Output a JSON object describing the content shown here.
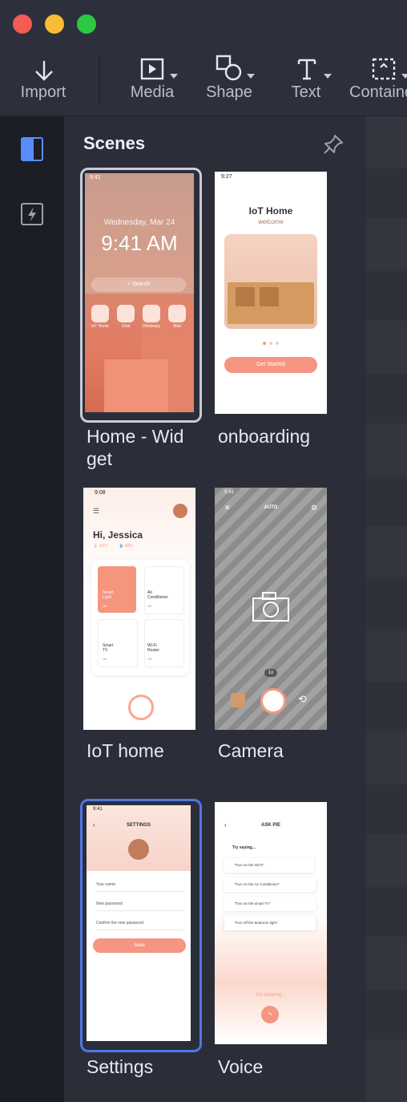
{
  "window": {
    "traffic_lights": [
      "#f35b53",
      "#f8bd34",
      "#2cc840"
    ]
  },
  "toolbar": {
    "import_label": "Import",
    "media_label": "Media",
    "shape_label": "Shape",
    "text_label": "Text",
    "container_label": "Containe"
  },
  "panel": {
    "title": "Scenes"
  },
  "scenes": [
    {
      "label": "Home - Wid\nget",
      "status_time": "9:41",
      "date": "Wednesday, Mar 24",
      "time": "9:41 AM",
      "search": "Search",
      "apps": [
        "IoT Home",
        "Chat",
        "Dictionary",
        "Mail"
      ]
    },
    {
      "label": "onboarding",
      "status_time": "9:27",
      "title": "IoT Home",
      "subtitle": "welcome",
      "cta": "Get Started"
    },
    {
      "label": "IoT home",
      "status_time": "9:08",
      "greeting": "Hi, Jessica",
      "temp": "23°C",
      "humidity": "40%",
      "devices": [
        {
          "name": "Smart\nLight",
          "state": "On"
        },
        {
          "name": "Air\nConditioner",
          "state": "Off"
        },
        {
          "name": "Smart\nTV",
          "state": "Off"
        },
        {
          "name": "Wi-Fi\nRouter",
          "state": "Off"
        }
      ]
    },
    {
      "label": "Camera",
      "status_time": "9:41",
      "mode": "AUTO",
      "zoom": "1x"
    },
    {
      "label": "Settings",
      "status_time": "9:41",
      "title": "SETTINGS",
      "fields": [
        "Your name",
        "New password",
        "Confirm the new password"
      ],
      "save": "Save"
    },
    {
      "label": "Voice",
      "title": "ASK PIE",
      "try": "Try saying...",
      "suggestions": [
        "\"Turn on the Wi-Fi\"",
        "\"Turn on the Air Conditioner\"",
        "\"Turn on the smart TV\"",
        "\"Turn off the bedroom light\""
      ],
      "listening": "I'm listening..."
    }
  ]
}
